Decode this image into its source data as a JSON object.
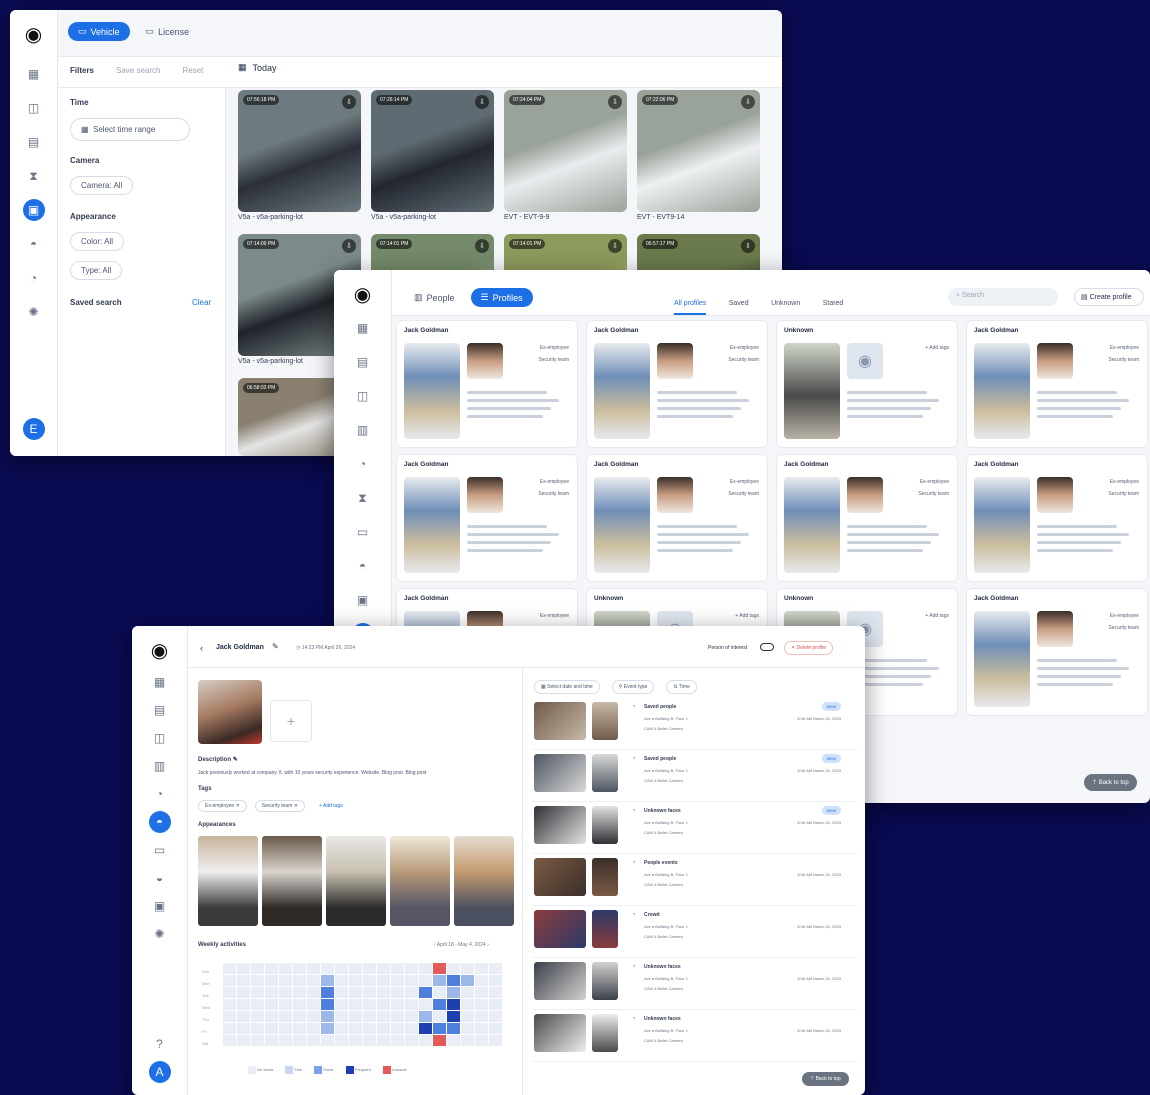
{
  "vehicle_window": {
    "tabs": [
      {
        "label": "Vehicle",
        "icon": "car-icon"
      },
      {
        "label": "License",
        "icon": "card-icon"
      }
    ],
    "filters_label": "Filters",
    "save_search": "Save search",
    "reset": "Reset",
    "date_label": "Today",
    "time_label": "Time",
    "time_button": "Select time range",
    "camera_label": "Camera",
    "camera_chip": "Camera: All",
    "appearance_label": "Appearance",
    "color_chip": "Color: All",
    "type_chip": "Type: All",
    "saved_search_label": "Saved search",
    "clear": "Clear",
    "avatar_initial": "E",
    "thumbs": [
      {
        "time": "07:56:18 PM",
        "caption": "V5a - v5a-parking-lot",
        "colors": [
          "#6d7a7f",
          "#2b2f38"
        ]
      },
      {
        "time": "07:26:14 PM",
        "caption": "V5a - v5a-parking-lot",
        "colors": [
          "#5f6b72",
          "#22262f"
        ]
      },
      {
        "time": "07:24:04 PM",
        "caption": "EVT - EVT-9-9",
        "colors": [
          "#9aa39a",
          "#e9ecee"
        ]
      },
      {
        "time": "07:22:06 PM",
        "caption": "EVT - EVT9-14",
        "colors": [
          "#9aa39a",
          "#eef0f2"
        ]
      },
      {
        "time": "07:14:09 PM",
        "caption": "V5a - v5a-parking-lot",
        "colors": [
          "#7c8a8a",
          "#1f232a"
        ]
      },
      {
        "time": "07:14:01 PM",
        "caption": "",
        "colors": [
          "#748a6a",
          "#a6b38c"
        ]
      },
      {
        "time": "07:14:01 PM",
        "caption": "",
        "colors": [
          "#8c9a5c",
          "#c4b470"
        ]
      },
      {
        "time": "06:57:17 PM",
        "caption": "",
        "colors": [
          "#6a7a4c",
          "#3b4a2a"
        ]
      },
      {
        "time": "06:58:03 PM",
        "caption": "",
        "colors": [
          "#8a8070",
          "#e4e4e4"
        ]
      }
    ]
  },
  "profiles_window": {
    "tabs": [
      {
        "label": "People",
        "icon": "people-icon"
      },
      {
        "label": "Profiles",
        "icon": "list-icon"
      }
    ],
    "subtabs": [
      "All profiles",
      "Saved",
      "Unknown",
      "Stared"
    ],
    "search_placeholder": "Search",
    "create_profile": "Create profile",
    "back_to_top": "Back to top",
    "cards": [
      {
        "name": "Jack Goldman",
        "tags": [
          "Ex-employee",
          "Security team"
        ],
        "unknown": false
      },
      {
        "name": "Jack Goldman",
        "tags": [
          "Ex-employee",
          "Security team"
        ],
        "unknown": false
      },
      {
        "name": "Unknown",
        "tags": [
          "+ Add tags"
        ],
        "unknown": true
      },
      {
        "name": "Jack Goldman",
        "tags": [
          "Ex-employee",
          "Security team"
        ],
        "unknown": false
      },
      {
        "name": "Jack Goldman",
        "tags": [
          "Ex-employee",
          "Security team"
        ],
        "unknown": false
      },
      {
        "name": "Jack Goldman",
        "tags": [
          "Ex-employee",
          "Security team"
        ],
        "unknown": false
      },
      {
        "name": "Jack Goldman",
        "tags": [
          "Ex-employee",
          "Security team"
        ],
        "unknown": false
      },
      {
        "name": "Jack Goldman",
        "tags": [
          "Ex-employee",
          "Security team"
        ],
        "unknown": false
      },
      {
        "name": "Jack Goldman",
        "tags": [
          "Ex-employee"
        ],
        "unknown": false
      },
      {
        "name": "Unknown",
        "tags": [
          "+ Add tags"
        ],
        "unknown": true
      },
      {
        "name": "Unknown",
        "tags": [
          "+ Add tags"
        ],
        "unknown": true
      },
      {
        "name": "Jack Goldman",
        "tags": [
          "Ex-employee",
          "Security team"
        ],
        "unknown": false
      }
    ]
  },
  "detail_window": {
    "name": "Jack Goldman",
    "timestamp": "14:23 PM April 26, 2024",
    "person_of_interest": "Person of interest",
    "delete_profile": "Delete profile",
    "description_label": "Description",
    "description_text": "Jack previously worked at company X. with 10 years security experience. Website. Blog post. Blog post",
    "tags_label": "Tags",
    "tags": [
      "Ex-employee",
      "Security team"
    ],
    "add_tags": "+ Add tags",
    "appearances_label": "Appearances",
    "weekly_label": "Weekly activities",
    "week_range": "April 18 - May 4, 2024",
    "days": [
      "Sun",
      "Mon",
      "Tue",
      "Wed",
      "Thu",
      "Fri",
      "Sat"
    ],
    "legend": [
      "No views",
      "Few",
      "Some",
      "Frequent",
      "Unusual"
    ],
    "feed_controls": [
      "Select date and time",
      "Event type",
      "Time"
    ],
    "feed": [
      {
        "event": "Saved people",
        "where": "Ave a Building B, Floor 1",
        "cam": "CAM 4 Bullet Camera",
        "date": "8:46 AM March 20, 2023",
        "badge": "NEW"
      },
      {
        "event": "Saved people",
        "where": "Ave a Building B, Floor 1",
        "cam": "CAM 4 Bullet Camera",
        "date": "8:46 AM March 20, 2023",
        "badge": "NEW"
      },
      {
        "event": "Unknown faces",
        "where": "Ave a Building B, Floor 1",
        "cam": "CAM 4 Bullet Camera",
        "date": "8:46 AM March 20, 2023",
        "badge": "NEW"
      },
      {
        "event": "People events",
        "where": "Ave a Building B, Floor 1",
        "cam": "CAM 4 Bullet Camera",
        "date": "8:46 AM March 20, 2023",
        "badge": ""
      },
      {
        "event": "Crowd",
        "where": "Ave a Building B, Floor 1",
        "cam": "CAM 4 Bullet Camera",
        "date": "8:46 AM March 20, 2023",
        "badge": ""
      },
      {
        "event": "Unknown faces",
        "where": "Ave a Building B, Floor 1",
        "cam": "CAM 4 Bullet Camera",
        "date": "8:46 AM March 20, 2023",
        "badge": ""
      },
      {
        "event": "Unknown faces",
        "where": "Ave a Building B, Floor 1",
        "cam": "CAM 4 Bullet Camera",
        "date": "8:46 AM March 20, 2023",
        "badge": ""
      }
    ],
    "back_to_top": "Back to top"
  }
}
